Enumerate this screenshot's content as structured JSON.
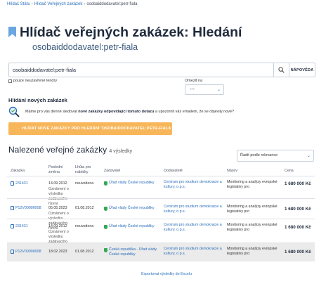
{
  "breadcrumb": [
    "Hlídač Státu",
    "Hlídač Veřejných zakázek",
    "osobaiddodavatel:petr-fiala"
  ],
  "page": {
    "title": "Hlídač veřejných zakázek: Hledání",
    "subtitle": "osobaiddodavatel:petr-fiala"
  },
  "search": {
    "value": "osobaiddodavatel:petr-fiala",
    "help_label": "NÁPOVĚDA",
    "only_unfinished_label": "pouze neuzavřené tendry"
  },
  "limit": {
    "label": "Omezit na",
    "value": "---"
  },
  "newsletter": {
    "title": "Hlídání nových zakázek",
    "text_before": "Máme pro vás denně sledovat ",
    "text_bold": "nové zakázky odpovídající tomuto dotazu",
    "text_after": " a upozornit vás emailem, že se objevily nové?",
    "button_label": "HLÍDAT NOVÉ ZAKÁZKY PRO HLEDÁNÍ 'OSOBAIDDODAVATEL:PETR-FIALA'"
  },
  "results": {
    "title": "Nalezené veřejné zakázky",
    "count": "4 výsledky",
    "sort": "Řadit podle relevance"
  },
  "table": {
    "headers": {
      "id": "Zakázka",
      "last_change": "Poslední změna",
      "deadline": "Lhůta pro nabídky",
      "authority": "Zadavatel",
      "supplier": "Dodavatelé",
      "name": "Název",
      "price": "Cena"
    },
    "rows": [
      {
        "id": "231431",
        "date": "14.09.2012",
        "note": "Oznámení o výsledku zadávacího řízení",
        "deadline": "neuvedena",
        "authority": "Úřad vlády České republiky",
        "supplier": "Centrum pro studium demokracie a kultury, o.p.s.",
        "name": "Monitoring a analýzy evropské legislativy pro",
        "price": "1 680 000 Kč"
      },
      {
        "id": "P12V00000008",
        "date": "05.05.2023",
        "note": "Oznámení o výsledku zadávacího řízení",
        "deadline": "01.08.2012",
        "authority": "Úřad vlády České republiky",
        "supplier": "Centrum pro studium demokracie a kultury, o.p.s.",
        "name": "Monitoring a analýzy evropské legislativy pro",
        "price": "1 680 000 Kč"
      },
      {
        "id": "231431",
        "date": "14.09.2012",
        "note": "Oznámení o výsledku zadávacího řízení",
        "deadline": "neuvedena",
        "authority": "Úřad vlády České republiky",
        "supplier": "Centrum pro studium demokracie a kultury, o.p.s.",
        "name": "Monitoring a analýzy evropské legislativy pro",
        "price": "1 680 000 Kč"
      },
      {
        "id": "P12V00000008",
        "date": "18.02.2023",
        "note": "",
        "deadline": "01.08.2012",
        "authority": "Česká republika - Úřad vlády České republiky",
        "supplier": "Centrum pro studium demokracie a kultury, o.p.s.",
        "name": "Monitoring a analýzy evropské legislativy pro",
        "price": "1 680 000 Kč"
      }
    ]
  },
  "export_label": "Exportovat výsledky do Excelu",
  "colors": {
    "accent": "#2a6ebb",
    "orange": "#f8b65a",
    "title": "#1f2a3c",
    "green": "#34a853"
  },
  "icons": {
    "bookmark": "bookmark-icon",
    "search": "search-icon",
    "watch": "magnifier-watch-icon",
    "eye": "eye-icon",
    "document": "document-icon",
    "shield": "shield-icon",
    "chevron": "chevron-down-icon"
  }
}
